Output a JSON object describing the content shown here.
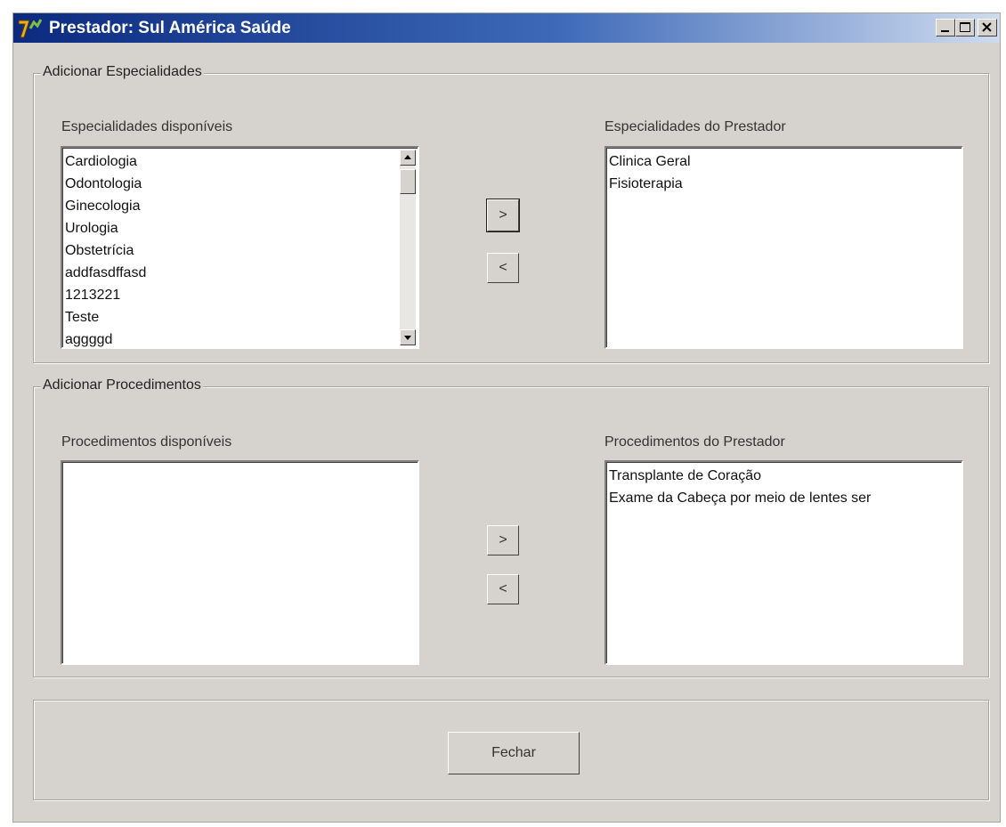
{
  "window": {
    "title": "Prestador: Sul América Saúde",
    "icon": "app-logo-icon",
    "controls": [
      "minimize-icon",
      "maximize-icon",
      "close-icon"
    ]
  },
  "especialidades": {
    "group_title": "Adicionar Especialidades",
    "available_label": "Especialidades disponíveis",
    "available_items": [
      "Cardiologia",
      "Odontologia",
      "Ginecologia",
      "Urologia",
      "Obstetrícia",
      "addfasdffasd",
      "1213221",
      "Teste",
      "aggggd"
    ],
    "assigned_label": "Especialidades do Prestador",
    "assigned_items": [
      "Clinica Geral",
      "Fisioterapia"
    ],
    "add_button": ">",
    "remove_button": "<"
  },
  "procedimentos": {
    "group_title": "Adicionar Procedimentos",
    "available_label": "Procedimentos disponíveis",
    "available_items": [],
    "assigned_label": "Procedimentos do Prestador",
    "assigned_items": [
      "Transplante de Coração",
      "Exame da Cabeça por meio de lentes ser"
    ],
    "add_button": ">",
    "remove_button": "<"
  },
  "footer": {
    "close_button": "Fechar"
  }
}
